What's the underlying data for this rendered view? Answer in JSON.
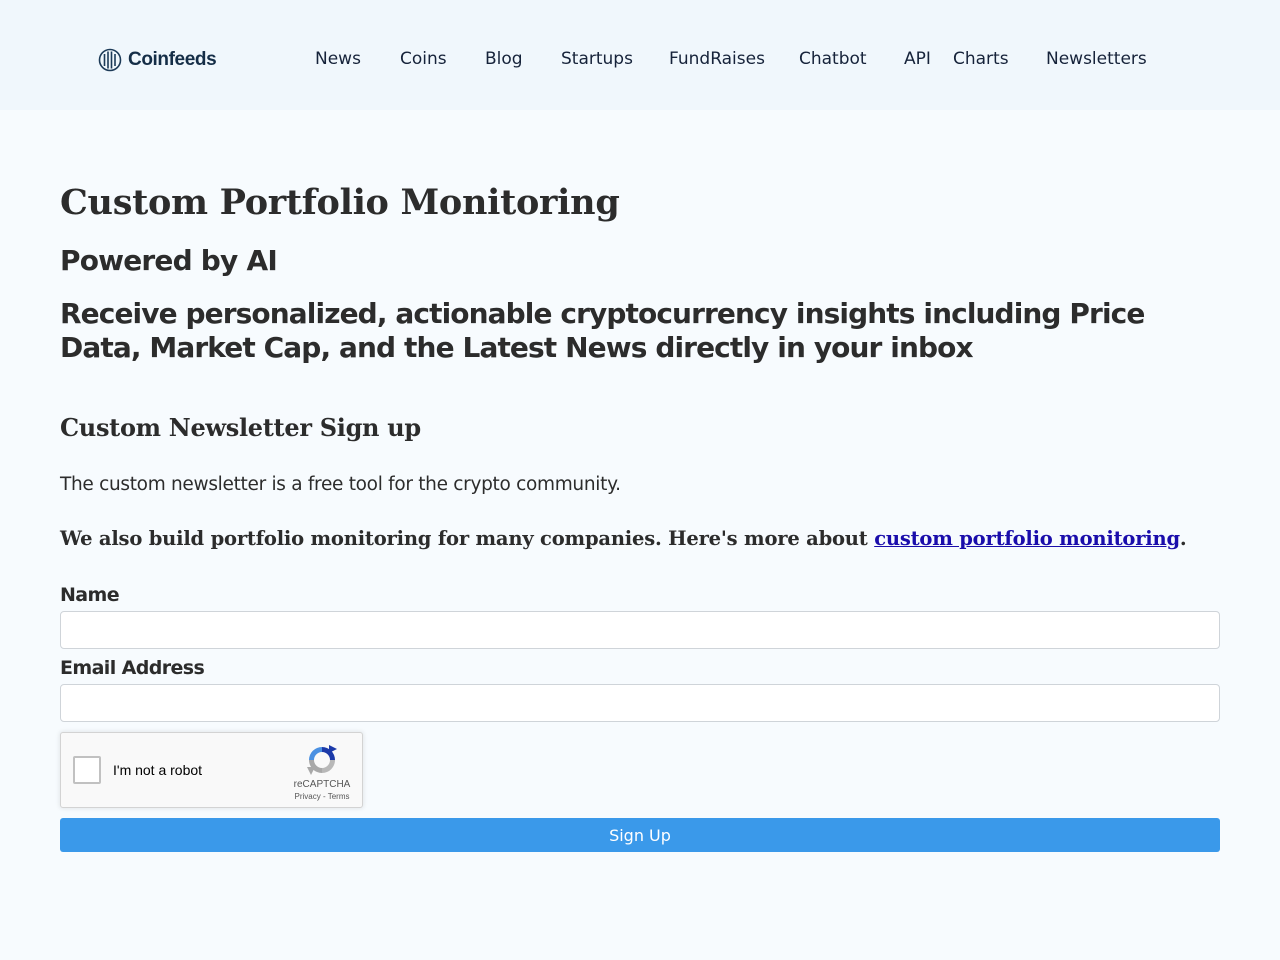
{
  "brand": {
    "name": "Coinfeeds"
  },
  "nav": [
    {
      "label": "News"
    },
    {
      "label": "Coins"
    },
    {
      "label": "Blog"
    },
    {
      "label": "Startups"
    },
    {
      "label": "FundRaises"
    },
    {
      "label": "Chatbot"
    },
    {
      "label": "API"
    },
    {
      "label": "Charts"
    },
    {
      "label": "Newsletters"
    }
  ],
  "hero": {
    "title": "Custom Portfolio Monitoring",
    "subtitle": "Powered by AI",
    "tagline": "Receive personalized, actionable cryptocurrency insights including Price Data, Market Cap, and the Latest News directly in your inbox"
  },
  "signup_section": {
    "heading": "Custom Newsletter Sign up",
    "intro": "The custom newsletter is a free tool for the crypto community.",
    "more_prefix": "We also build portfolio monitoring for many companies. Here's more about ",
    "more_link": "custom portfolio monitoring",
    "more_suffix": "."
  },
  "form": {
    "name_label": "Name",
    "name_value": "",
    "email_label": "Email Address",
    "email_value": "",
    "submit_label": "Sign Up"
  },
  "captcha": {
    "label": "I'm not a robot",
    "brand": "reCAPTCHA",
    "privacy": "Privacy",
    "separator": " - ",
    "terms": "Terms",
    "checked": false
  },
  "colors": {
    "header_bg": "#f0f7fc",
    "page_bg": "#f7fbfe",
    "button_bg": "#3a99ea",
    "link": "#1a0dab"
  }
}
